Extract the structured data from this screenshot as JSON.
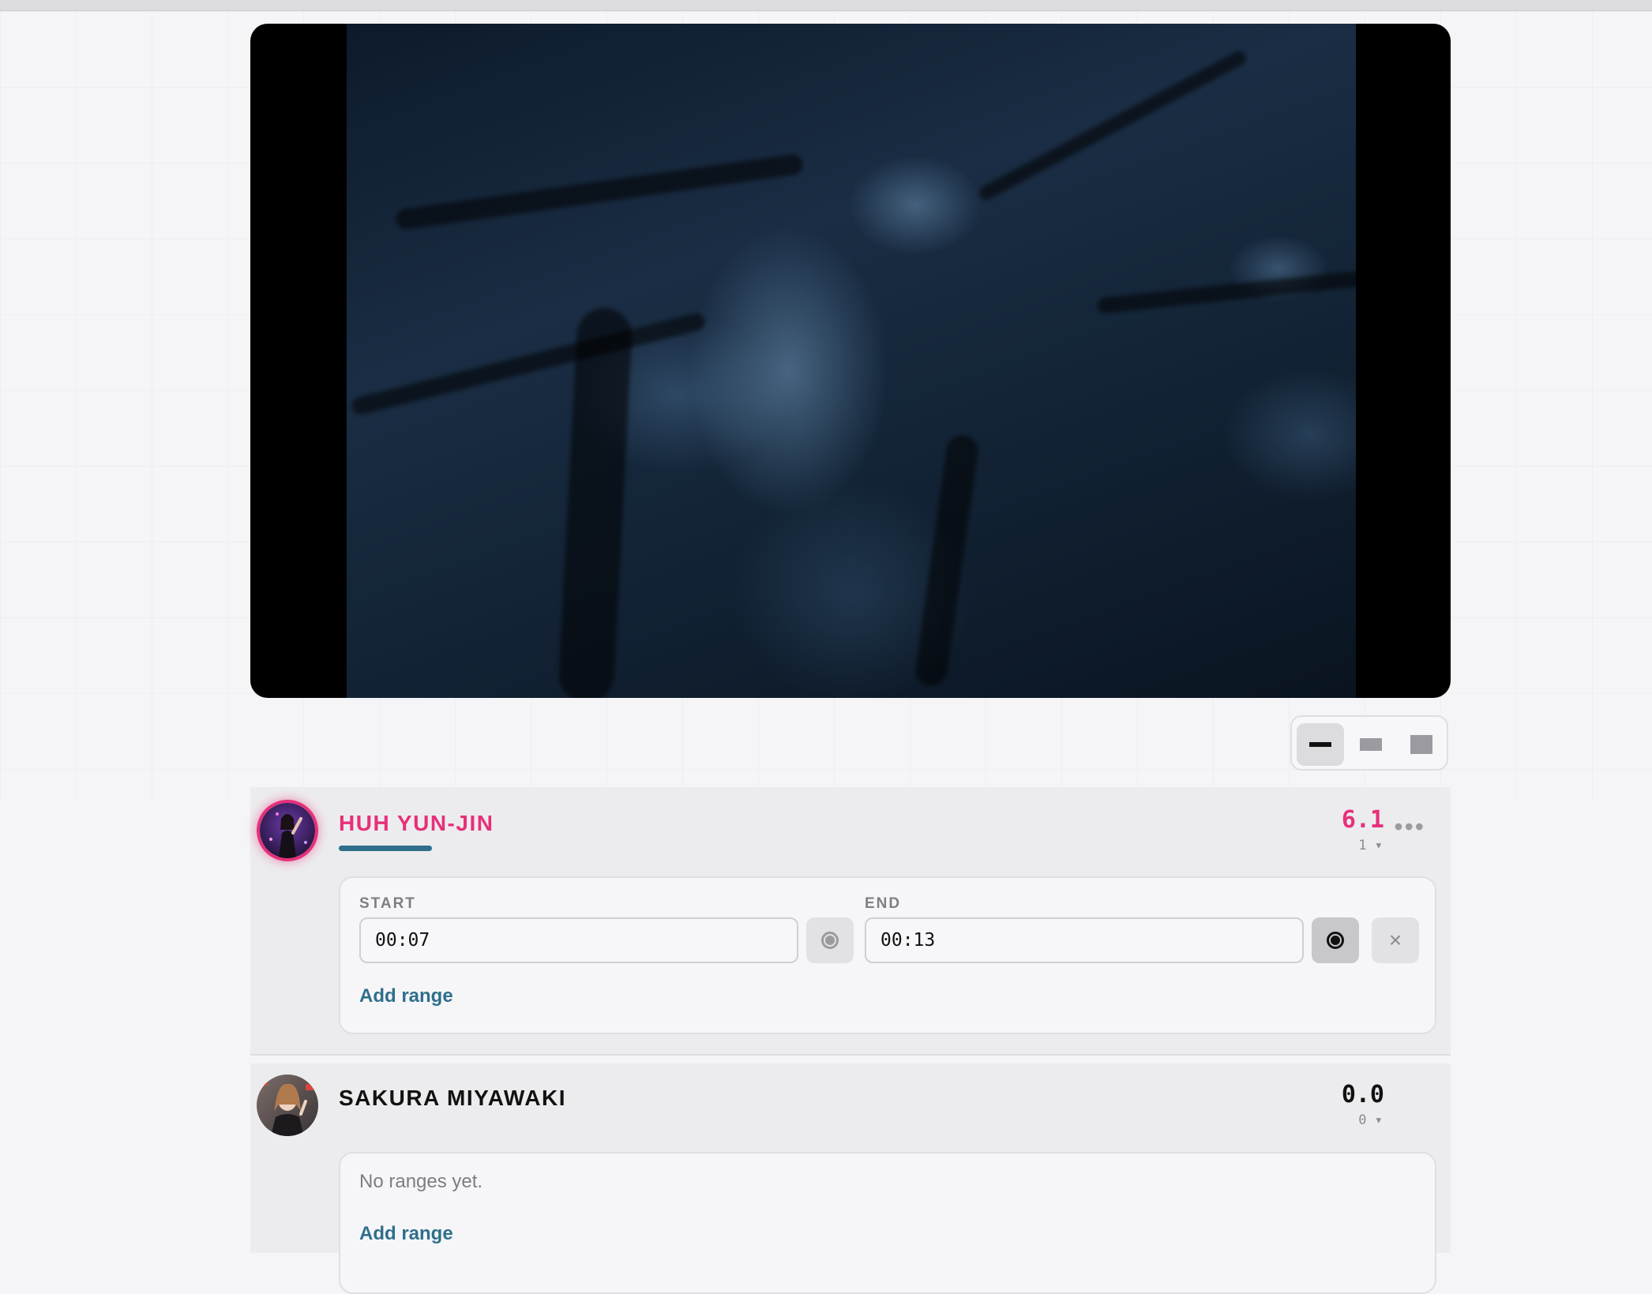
{
  "layout_modes": [
    {
      "name": "compact",
      "active": true
    },
    {
      "name": "medium",
      "active": false
    },
    {
      "name": "large",
      "active": false
    }
  ],
  "members": [
    {
      "name": "HUH YUN-JIN",
      "name_color": "#e6307a",
      "score": "6.1",
      "score_color": "#e6307a",
      "count": "1 ▾",
      "menu": "•••",
      "ranges": [
        {
          "start_label": "START",
          "start": "00:07",
          "end_label": "END",
          "end": "00:13",
          "remove": "×"
        }
      ],
      "add_range": "Add range"
    },
    {
      "name": "SAKURA MIYAWAKI",
      "name_color": "#111111",
      "score": "0.0",
      "score_color": "#111111",
      "count": "0 ▾",
      "empty_text": "No ranges yet.",
      "add_range": "Add range"
    }
  ],
  "colors": {
    "accent": "#e6307a",
    "link": "#2f6f8c",
    "card": "#ececee"
  }
}
